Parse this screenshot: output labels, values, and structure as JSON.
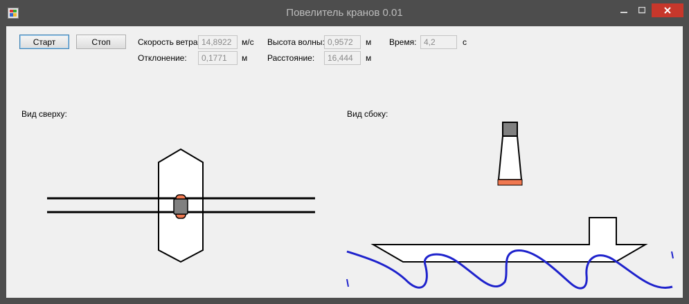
{
  "window": {
    "title": "Повелитель кранов 0.01"
  },
  "controls": {
    "start_label": "Старт",
    "stop_label": "Стоп"
  },
  "fields": {
    "wind_speed": {
      "label": "Скорость ветра:",
      "value": "14,8922",
      "unit": "м/с"
    },
    "wave_height": {
      "label": "Высота волны:",
      "value": "0,9572",
      "unit": "м"
    },
    "time": {
      "label": "Время:",
      "value": "4,2",
      "unit": "с"
    },
    "deviation": {
      "label": "Отклонение:",
      "value": "0,1771",
      "unit": "м"
    },
    "distance": {
      "label": "Расстояние:",
      "value": "16,444",
      "unit": "м"
    }
  },
  "views": {
    "top_label": "Вид сверху:",
    "side_label": "Вид сбоку:"
  },
  "colors": {
    "client_bg": "#f0f0f0",
    "close_button": "#c7372b",
    "load_orange": "#f07850",
    "load_gray": "#808080",
    "wave_blue": "#1e22cc"
  }
}
